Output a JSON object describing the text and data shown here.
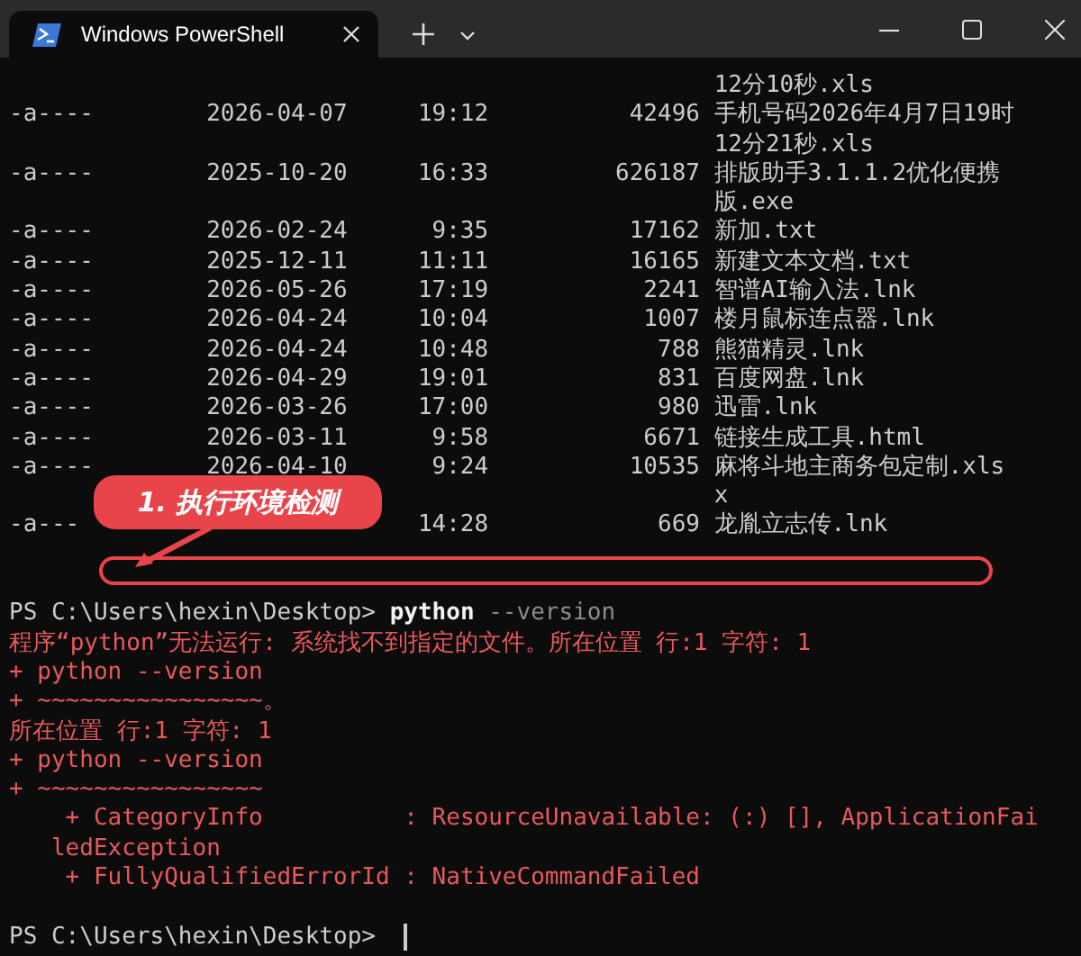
{
  "window": {
    "tab_title": "Windows PowerShell"
  },
  "listing": [
    {
      "kind": "wrap",
      "text": "12分10秒.xls"
    },
    {
      "kind": "file",
      "mode": "-a----",
      "date": "2026-04-07",
      "time": "19:12",
      "size": "42496",
      "name": "手机号码2026年4月7日19时"
    },
    {
      "kind": "wrap",
      "text": "12分21秒.xls"
    },
    {
      "kind": "file",
      "mode": "-a----",
      "date": "2025-10-20",
      "time": "16:33",
      "size": "626187",
      "name": "排版助手3.1.1.2优化便携"
    },
    {
      "kind": "wrap",
      "text": "版.exe"
    },
    {
      "kind": "file",
      "mode": "-a----",
      "date": "2026-02-24",
      "time": "9:35",
      "size": "17162",
      "name": "新加.txt"
    },
    {
      "kind": "file",
      "mode": "-a----",
      "date": "2025-12-11",
      "time": "11:11",
      "size": "16165",
      "name": "新建文本文档.txt"
    },
    {
      "kind": "file",
      "mode": "-a----",
      "date": "2026-05-26",
      "time": "17:19",
      "size": "2241",
      "name": "智谱AI输入法.lnk"
    },
    {
      "kind": "file",
      "mode": "-a----",
      "date": "2026-04-24",
      "time": "10:04",
      "size": "1007",
      "name": "楼月鼠标连点器.lnk"
    },
    {
      "kind": "file",
      "mode": "-a----",
      "date": "2026-04-24",
      "time": "10:48",
      "size": "788",
      "name": "熊猫精灵.lnk"
    },
    {
      "kind": "file",
      "mode": "-a----",
      "date": "2026-04-29",
      "time": "19:01",
      "size": "831",
      "name": "百度网盘.lnk"
    },
    {
      "kind": "file",
      "mode": "-a----",
      "date": "2026-03-26",
      "time": "17:00",
      "size": "980",
      "name": "迅雷.lnk"
    },
    {
      "kind": "file",
      "mode": "-a----",
      "date": "2026-03-11",
      "time": "9:58",
      "size": "6671",
      "name": "链接生成工具.html"
    },
    {
      "kind": "file",
      "mode": "-a----",
      "date": "2026-04-10",
      "time": "9:24",
      "size": "10535",
      "name": "麻将斗地主商务包定制.xls"
    },
    {
      "kind": "wrap",
      "text": "x"
    },
    {
      "kind": "file",
      "mode": "-a---",
      "time": "14:28",
      "size": "669",
      "name": "龙胤立志传.lnk"
    },
    {
      "kind": "blank"
    },
    {
      "kind": "blank"
    },
    {
      "kind": "prompt",
      "prompt": "PS C:\\Users\\hexin\\Desktop>",
      "command": "python",
      "args": "--version"
    },
    {
      "kind": "error",
      "text": "程序“python”无法运行: 系统找不到指定的文件。所在位置 行:1 字符: 1"
    },
    {
      "kind": "error",
      "text": "+ python --version"
    },
    {
      "kind": "error",
      "text": "+ ~~~~~~~~~~~~~~~~。"
    },
    {
      "kind": "error",
      "text": "所在位置 行:1 字符: 1"
    },
    {
      "kind": "error",
      "text": "+ python --version"
    },
    {
      "kind": "error",
      "text": "+ ~~~~~~~~~~~~~~~~"
    },
    {
      "kind": "error",
      "text": "    + CategoryInfo          : ResourceUnavailable: (:) [], ApplicationFai"
    },
    {
      "kind": "error",
      "text": "   ledException"
    },
    {
      "kind": "error",
      "text": "    + FullyQualifiedErrorId : NativeCommandFailed"
    },
    {
      "kind": "blank"
    },
    {
      "kind": "prompt",
      "prompt": "PS C:\\Users\\hexin\\Desktop>",
      "cursor": true
    }
  ],
  "annotation": {
    "label": "1. 执行环境检测"
  }
}
